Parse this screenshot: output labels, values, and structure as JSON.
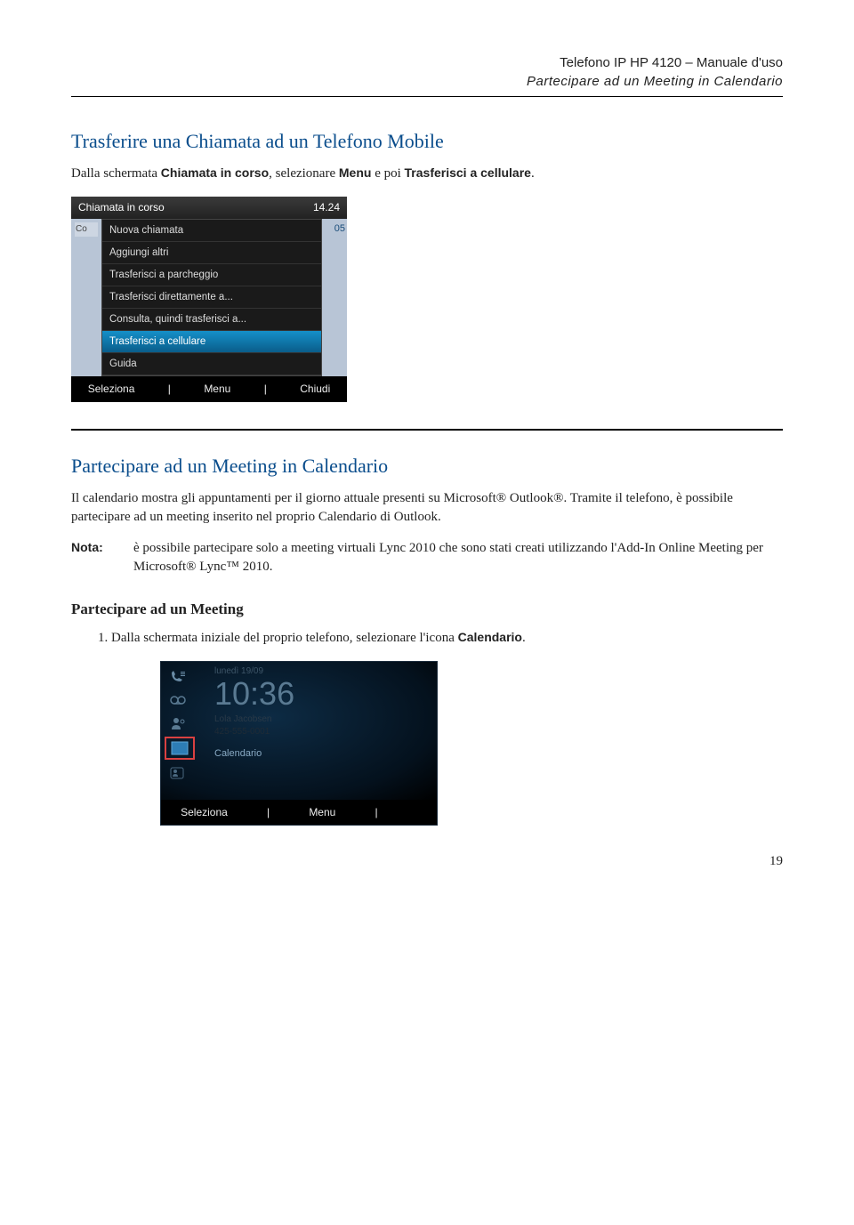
{
  "header": {
    "title": "Telefono IP HP 4120 – Manuale d'uso",
    "subtitle": "Partecipare ad un Meeting in Calendario"
  },
  "section1": {
    "heading": "Trasferire una Chiamata ad un Telefono Mobile",
    "para_prefix": "Dalla schermata ",
    "para_bold1": "Chiamata in corso",
    "para_mid": ", selezionare ",
    "para_bold2": "Menu",
    "para_mid2": " e poi ",
    "para_bold3": "Trasferisci a cellulare",
    "para_end": "."
  },
  "phone1": {
    "title": "Chiamata in corso",
    "time": "14.24",
    "left_lbl": "Co",
    "right_lbl": "05",
    "menu": [
      "Nuova chiamata",
      "Aggiungi altri",
      "Trasferisci a parcheggio",
      "Trasferisci direttamente a...",
      "Consulta, quindi trasferisci a...",
      "Trasferisci a cellulare",
      "Guida"
    ],
    "softkeys": [
      "Seleziona",
      "Menu",
      "Chiudi"
    ]
  },
  "section2": {
    "heading": "Partecipare ad un Meeting in Calendario",
    "para1": "Il calendario mostra gli appuntamenti per il giorno attuale presenti su Microsoft® Outlook®. Tramite il telefono, è possibile partecipare ad un meeting inserito nel proprio Calendario di Outlook.",
    "note_label": "Nota:",
    "note_text": "è possibile partecipare solo a meeting virtuali Lync 2010 che sono stati creati utilizzando l'Add-In Online Meeting per Microsoft® Lync™ 2010.",
    "subheading": "Partecipare ad un Meeting",
    "step1_pre": "Dalla schermata iniziale del proprio telefono, selezionare l'icona ",
    "step1_bold": "Calendario",
    "step1_end": "."
  },
  "phone2": {
    "date": "lunedì 19/09",
    "time": "10:36",
    "name": "Lola Jacobsen",
    "number": "425-555-0001",
    "cal_label": "Calendario",
    "softkeys": [
      "Seleziona",
      "Menu",
      ""
    ]
  },
  "page_number": "19"
}
